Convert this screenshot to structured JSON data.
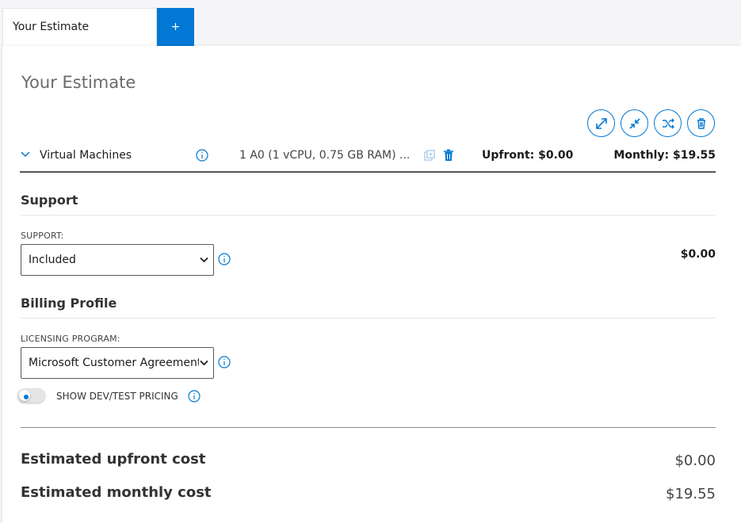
{
  "tabs": [
    {
      "label": "Your Estimate"
    }
  ],
  "add_tab_label": "+",
  "estimate": {
    "title": "Your Estimate",
    "toolbar": {
      "expand_all": "expand-all-icon",
      "collapse_all": "collapse-all-icon",
      "shuffle": "shuffle-icon",
      "delete_all": "trash-icon"
    },
    "vm": {
      "name": "Virtual Machines",
      "description": "1 A0 (1 vCPU, 0.75 GB RAM) ...",
      "upfront": "Upfront: $0.00",
      "monthly": "Monthly: $19.55"
    },
    "support": {
      "heading": "Support",
      "label": "SUPPORT:",
      "value": "Included",
      "amount": "$0.00"
    },
    "billing": {
      "heading": "Billing Profile",
      "label": "LICENSING PROGRAM:",
      "value": "Microsoft Customer Agreement",
      "toggle_label": "SHOW DEV/TEST PRICING",
      "toggle_on": false
    },
    "totals": {
      "upfront_label": "Estimated upfront cost",
      "upfront_value": "$0.00",
      "monthly_label": "Estimated monthly cost",
      "monthly_value": "$19.55"
    }
  },
  "colors": {
    "accent": "#0078d4",
    "text": "#1b1b1b",
    "muted": "#6b6b6b"
  }
}
